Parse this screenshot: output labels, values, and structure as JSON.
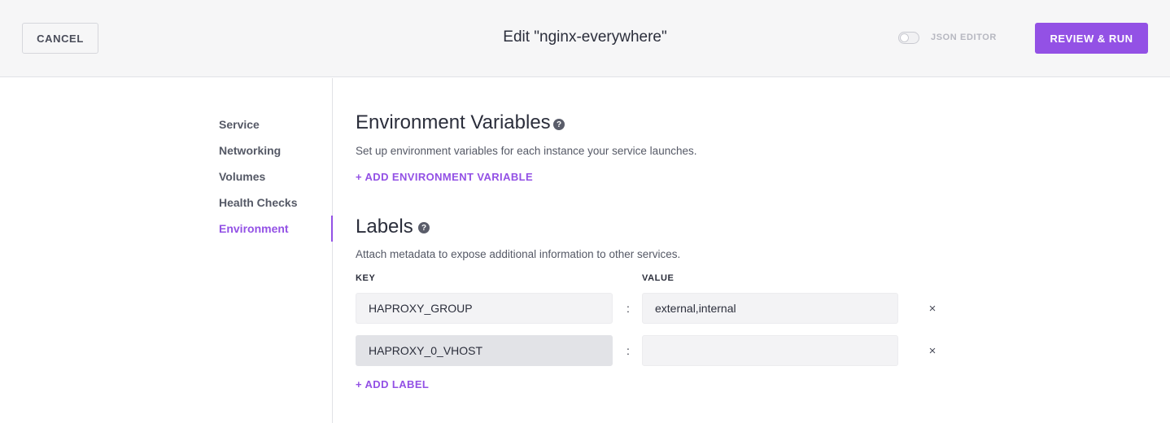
{
  "header": {
    "cancel_label": "CANCEL",
    "title": "Edit \"nginx-everywhere\"",
    "json_editor_label": "JSON EDITOR",
    "json_editor_enabled": false,
    "review_label": "REVIEW & RUN"
  },
  "sidebar": {
    "items": [
      {
        "label": "Service"
      },
      {
        "label": "Networking"
      },
      {
        "label": "Volumes"
      },
      {
        "label": "Health Checks"
      },
      {
        "label": "Environment",
        "active": true
      }
    ]
  },
  "env": {
    "title": "Environment Variables",
    "description": "Set up environment variables for each instance your service launches.",
    "add_label": "+ ADD ENVIRONMENT VARIABLE"
  },
  "labels": {
    "title": "Labels",
    "description": "Attach metadata to expose additional information to other services.",
    "key_header": "KEY",
    "value_header": "VALUE",
    "separator": ":",
    "rows": [
      {
        "key": "HAPROXY_GROUP",
        "value": "external,internal"
      },
      {
        "key": "HAPROXY_0_VHOST",
        "value": ""
      }
    ],
    "add_label": "+ ADD LABEL"
  },
  "icons": {
    "help": "help-circle-icon",
    "remove": "close-icon",
    "remove_glyph": "×",
    "help_glyph": "?"
  },
  "colors": {
    "accent": "#9351e5",
    "header_bg": "#f6f6f7",
    "text": "#2b2e3b"
  }
}
